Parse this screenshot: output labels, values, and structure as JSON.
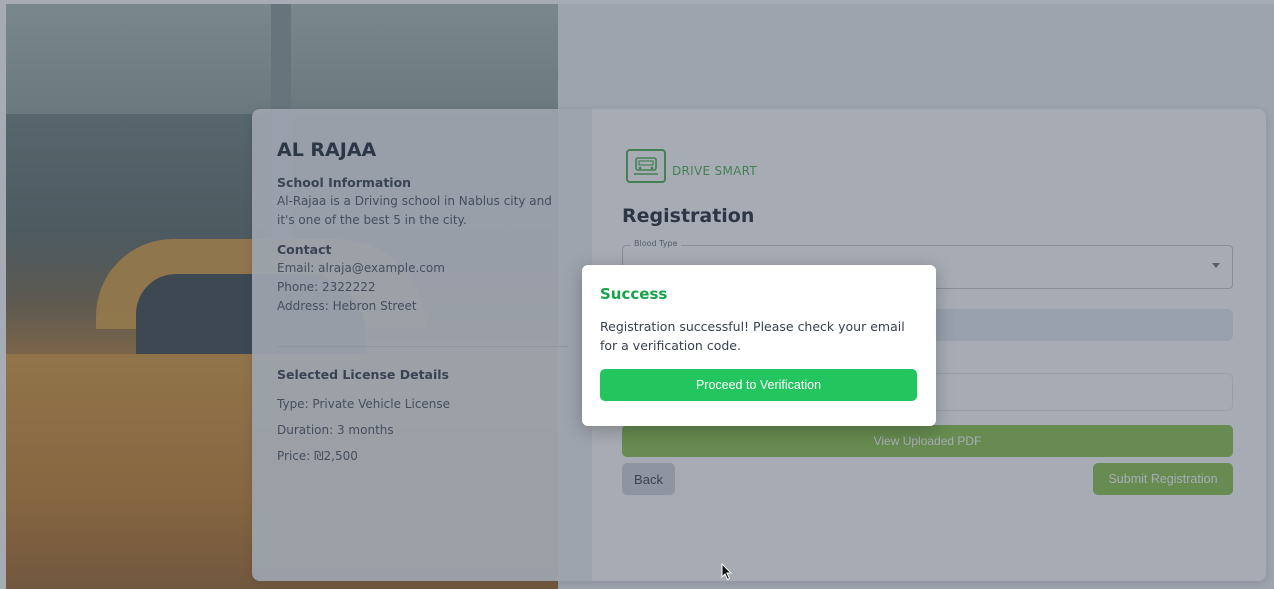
{
  "school": {
    "name": "AL RAJAA",
    "info_heading": "School Information",
    "info_text": "Al-Rajaa is a Driving school in Nablus city and it's one of the best 5 in the city.",
    "contact_heading": "Contact",
    "email": "Email: alraja@example.com",
    "phone": "Phone: 2322222",
    "address": "Address: Hebron Street"
  },
  "license": {
    "heading": "Selected License Details",
    "type": "Type: Private Vehicle License",
    "duration": "Duration: 3 months",
    "price": "Price: ₪2,500"
  },
  "form": {
    "brand": "DRIVE SMART",
    "title": "Registration",
    "blood_type_label": "Blood Type",
    "blood_type_value": "",
    "view_pdf_label": "View Uploaded PDF",
    "back_label": "Back",
    "submit_label": "Submit Registration"
  },
  "dialog": {
    "title": "Success",
    "message": "Registration successful! Please check your email for a verification code.",
    "button_label": "Proceed to Verification"
  },
  "colors": {
    "success_green": "#16a34a",
    "button_green": "#22c55e",
    "brand_green": "#4caf50",
    "muted_green": "#8bc34a"
  }
}
